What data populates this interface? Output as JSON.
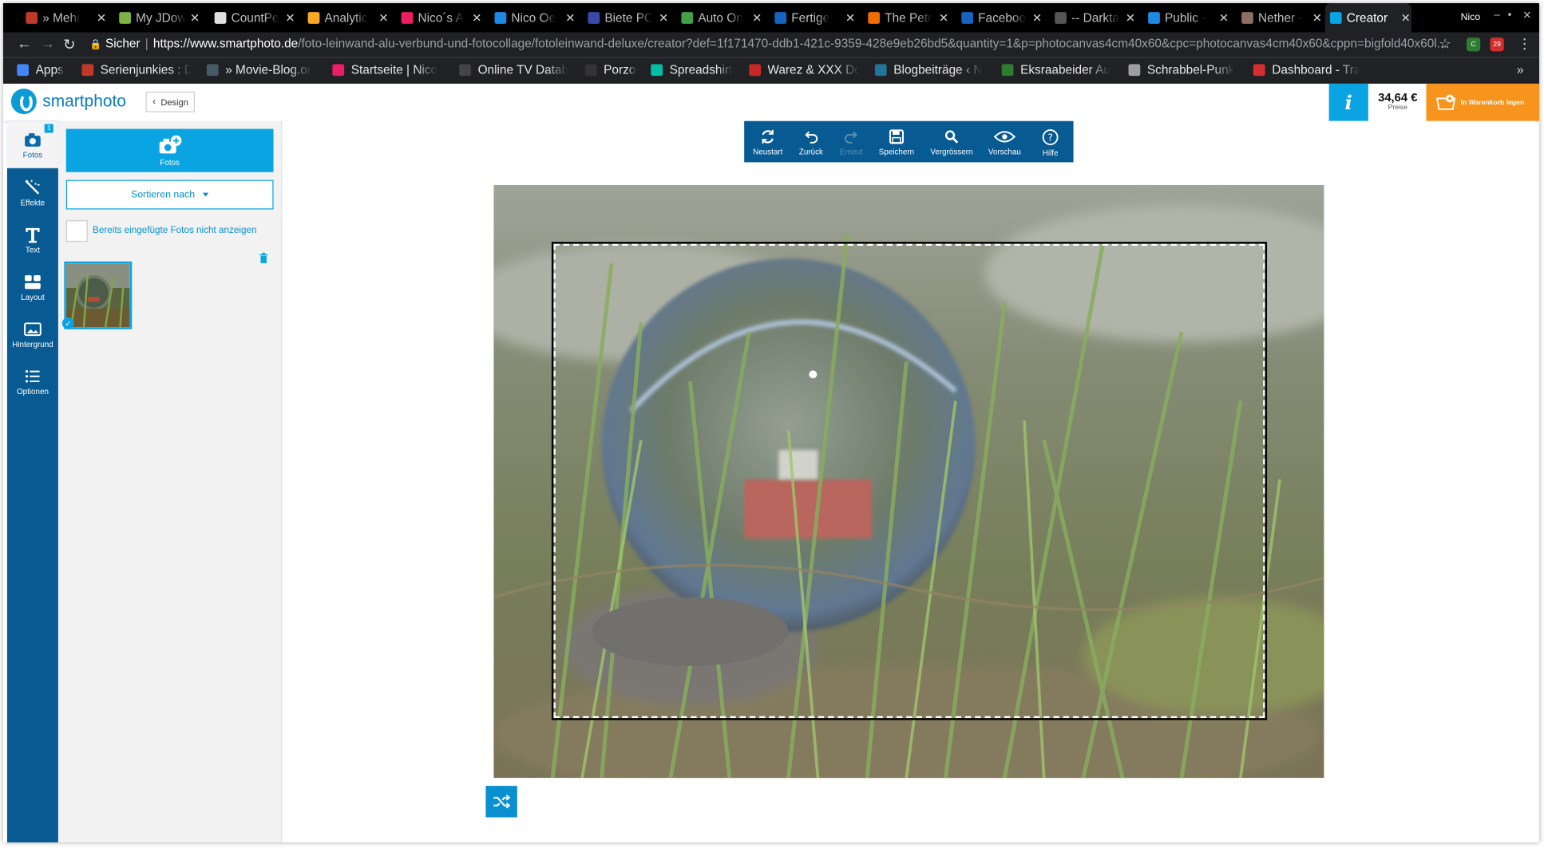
{
  "browser": {
    "tabs": [
      {
        "label": "» Mehr",
        "icon_color": "#c0392b"
      },
      {
        "label": "My JDow",
        "icon_color": "#7cb342"
      },
      {
        "label": "CountPe",
        "icon_color": "#e0e0e0"
      },
      {
        "label": "Analytic",
        "icon_color": "#f9a825"
      },
      {
        "label": "Nico´s A",
        "icon_color": "#e91e63"
      },
      {
        "label": "Nico Oe",
        "icon_color": "#1e88e5"
      },
      {
        "label": "Biete PC",
        "icon_color": "#3949ab"
      },
      {
        "label": "Auto On",
        "icon_color": "#43a047"
      },
      {
        "label": "Fertige",
        "icon_color": "#1565c0"
      },
      {
        "label": "The Petr",
        "icon_color": "#ef6c00"
      },
      {
        "label": "Faceboo",
        "icon_color": "#1565c0"
      },
      {
        "label": "-- Darkta",
        "icon_color": "#555555"
      },
      {
        "label": "Public -",
        "icon_color": "#1e88e5"
      },
      {
        "label": "Nether -",
        "icon_color": "#8d6e63"
      },
      {
        "label": "Creator",
        "icon_color": "#0aa4e3"
      }
    ],
    "profile": "Nico",
    "secure_label": "Sicher",
    "url_host": "https://www.smartphoto.de",
    "url_path": "/foto-leinwand-alu-verbund-und-fotocollage/fotoleinwand-deluxe/creator?def=1f171470-ddb1-421c-9359-428e9eb26bd5&quantity=1&p=photocanvas4cm40x60&cpc=photocanvas4cm40x60&cppn=bigfold40x60l...",
    "ext_badge": "29",
    "bookmarks": [
      {
        "label": "Apps",
        "icon_color": "#4285f4"
      },
      {
        "label": "Serienjunkies : D",
        "icon_color": "#c0392b"
      },
      {
        "label": "» Movie-Blog.or",
        "icon_color": "#455a64"
      },
      {
        "label": "Startseite | Nico",
        "icon_color": "#e91e63"
      },
      {
        "label": "Online TV Datab",
        "icon_color": "#444444"
      },
      {
        "label": "Porzo",
        "icon_color": "#333333"
      },
      {
        "label": "Spreadshirt",
        "icon_color": "#00bfa5"
      },
      {
        "label": "Warez & XXX Do",
        "icon_color": "#c62828"
      },
      {
        "label": "Blogbeiträge ‹ N",
        "icon_color": "#21759b"
      },
      {
        "label": "Eksraabeider Au",
        "icon_color": "#2e7d32"
      },
      {
        "label": "Schrabbel-Punk",
        "icon_color": "#9e9e9e"
      },
      {
        "label": "Dashboard - Tra",
        "icon_color": "#d32f2f"
      }
    ],
    "bookmarks_more": "»"
  },
  "app": {
    "logo_text": "smartphoto",
    "back_button": "Design",
    "price": "34,64 €",
    "price_label": "Preise",
    "cart_label": "In Warenkorb legen",
    "info_label": "i"
  },
  "leftnav": {
    "items": [
      {
        "label": "Fotos",
        "icon": "camera-icon"
      },
      {
        "label": "Effekte",
        "icon": "magic-wand-icon"
      },
      {
        "label": "Text",
        "icon": "text-icon"
      },
      {
        "label": "Layout",
        "icon": "layout-icon"
      },
      {
        "label": "Hintergrund",
        "icon": "image-background-icon"
      },
      {
        "label": "Optionen",
        "icon": "list-icon"
      }
    ],
    "photos_badge": "1"
  },
  "panel": {
    "add_photos_label": "Fotos",
    "sort_label": "Sortieren nach",
    "hide_used_label": "Bereits eingefügte Fotos nicht anzeigen",
    "hide_used_checked": false
  },
  "toolbar": {
    "items": [
      {
        "label": "Neustart",
        "icon": "refresh-icon",
        "enabled": true
      },
      {
        "label": "Zurück",
        "icon": "undo-icon",
        "enabled": true
      },
      {
        "label": "Erneut",
        "icon": "redo-icon",
        "enabled": false
      },
      {
        "label": "Speichern",
        "icon": "save-icon",
        "enabled": true
      },
      {
        "label": "Vergrössern",
        "icon": "zoom-icon",
        "enabled": true
      },
      {
        "label": "Vorschau",
        "icon": "eye-icon",
        "enabled": true
      },
      {
        "label": "Hilfe",
        "icon": "help-icon",
        "enabled": true
      }
    ]
  },
  "colors": {
    "brand_blue": "#0aa4e3",
    "nav_blue": "#075a92",
    "cart_orange": "#f7941d"
  }
}
